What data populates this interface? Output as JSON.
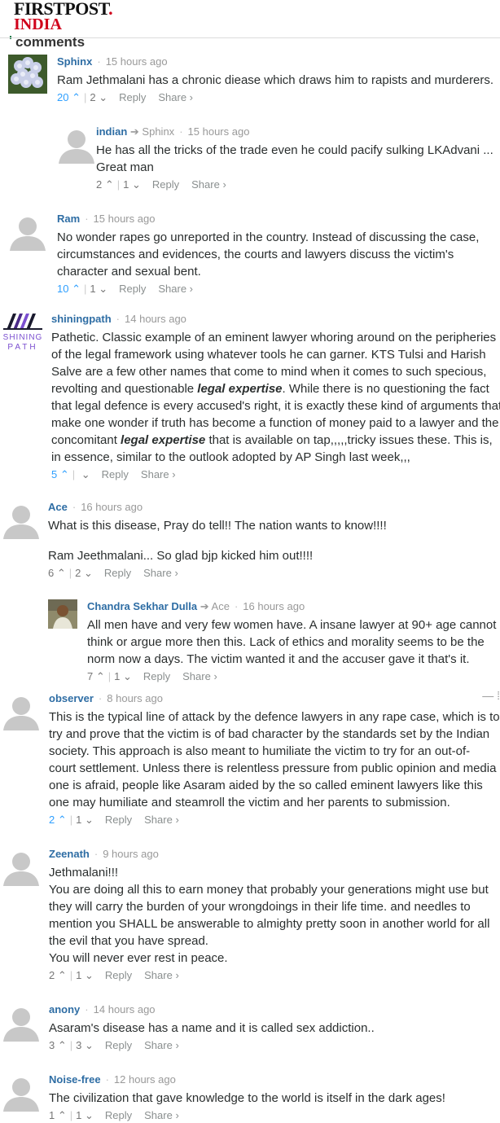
{
  "header": {
    "logo_main": "FIRSTPOST",
    "logo_dot": ".",
    "logo_sub": "INDIA",
    "section_title": "comments"
  },
  "labels": {
    "reply": "Reply",
    "share": "Share ›",
    "reply_arrow": "➔"
  },
  "comments": [
    {
      "author": "Sphinx",
      "reply_to": "",
      "time": "15 hours ago",
      "lines": [
        "Ram Jethmalani has a chronic diease which draws him to rapists and murderers."
      ],
      "up": "20",
      "down": "2",
      "up_active": true
    },
    {
      "author": "indian",
      "reply_to": "Sphinx",
      "time": "15 hours ago",
      "lines": [
        "He has all the tricks of the trade even he could pacify sulking LKAdvani ...",
        "Great man"
      ],
      "up": "2",
      "down": "1",
      "up_active": false
    },
    {
      "author": "Ram",
      "reply_to": "",
      "time": "15 hours ago",
      "lines": [
        "No wonder rapes go unreported in the country. Instead of discussing the case,",
        "circumstances and evidences, the courts and lawyers discuss the victim's",
        "character and sexual bent."
      ],
      "up": "10",
      "down": "1",
      "up_active": true
    },
    {
      "author": "shiningpath",
      "reply_to": "",
      "time": "14 hours ago",
      "lines": [
        "Pathetic. Classic example of an eminent lawyer whoring around on the peripheries",
        "of the legal framework using whatever tools he can garner. KTS Tulsi and Harish",
        "Salve are a few other names that come to mind when it comes to such specious,",
        "revolting and questionable legal expertise. While there is no questioning the fact",
        "that legal defence is every accused's right, it is exactly these kind of arguments that",
        "make one wonder if truth has become a function of money paid to a lawyer and the",
        "concomitant legal expertise that is available on tap,,,,,tricky issues these. This is,",
        "in essence, similar to the outlook adopted by AP Singh last week,,,"
      ],
      "up": "5",
      "down": "",
      "up_active": true
    },
    {
      "author": "Ace",
      "reply_to": "",
      "time": "16 hours ago",
      "lines": [
        "What is this disease, Pray do tell!! The nation wants to know!!!!",
        "",
        "Ram Jeethmalani... So glad bjp kicked him out!!!!"
      ],
      "up": "6",
      "down": "2",
      "up_active": false
    },
    {
      "author": "Chandra Sekhar Dulla",
      "reply_to": "Ace",
      "time": "16 hours ago",
      "lines": [
        "All men have and very few women have. A insane lawyer at 90+ age cannot",
        "think or argue more then this. Lack of ethics and morality seems to be the",
        "norm now a days. The victim wanted it and the accuser gave it that's it."
      ],
      "up": "7",
      "down": "1",
      "up_active": false
    },
    {
      "author": "observer",
      "reply_to": "",
      "time": "8 hours ago",
      "lines": [
        "This is the typical line of attack by the defence lawyers in any rape case, which is to",
        "try and prove that the victim is of bad character by the standards set by the Indian",
        "society. This approach is also meant to humiliate the victim to try for an out-of-",
        "court settlement. Unless there is relentless pressure from public opinion and media",
        "one is afraid, people like Asaram aided by the so called eminent lawyers like this",
        "one may humiliate and steamroll the victim and her parents to submission."
      ],
      "up": "2",
      "down": "1",
      "up_active": true
    },
    {
      "author": "Zeenath",
      "reply_to": "",
      "time": "9 hours ago",
      "lines": [
        "Jethmalani!!!",
        "You are doing all this to earn money that probably your generations might use but",
        "they will carry the burden of your wrongdoings in their life time. and needles to",
        "mention you SHALL be answerable to almighty pretty soon in another world for all",
        "the evil that you have spread.",
        "You will never ever rest in peace."
      ],
      "up": "2",
      "down": "1",
      "up_active": false
    },
    {
      "author": "anony",
      "reply_to": "",
      "time": "14 hours ago",
      "lines": [
        "Asaram's disease has a name and it is called sex addiction.."
      ],
      "up": "3",
      "down": "3",
      "up_active": false
    },
    {
      "author": "Noise-free",
      "reply_to": "",
      "time": "12 hours ago",
      "lines": [
        "The civilization that gave knowledge to the world is itself in the dark ages!"
      ],
      "up": "1",
      "down": "1",
      "up_active": false
    }
  ],
  "menu_control": "— ⁞"
}
